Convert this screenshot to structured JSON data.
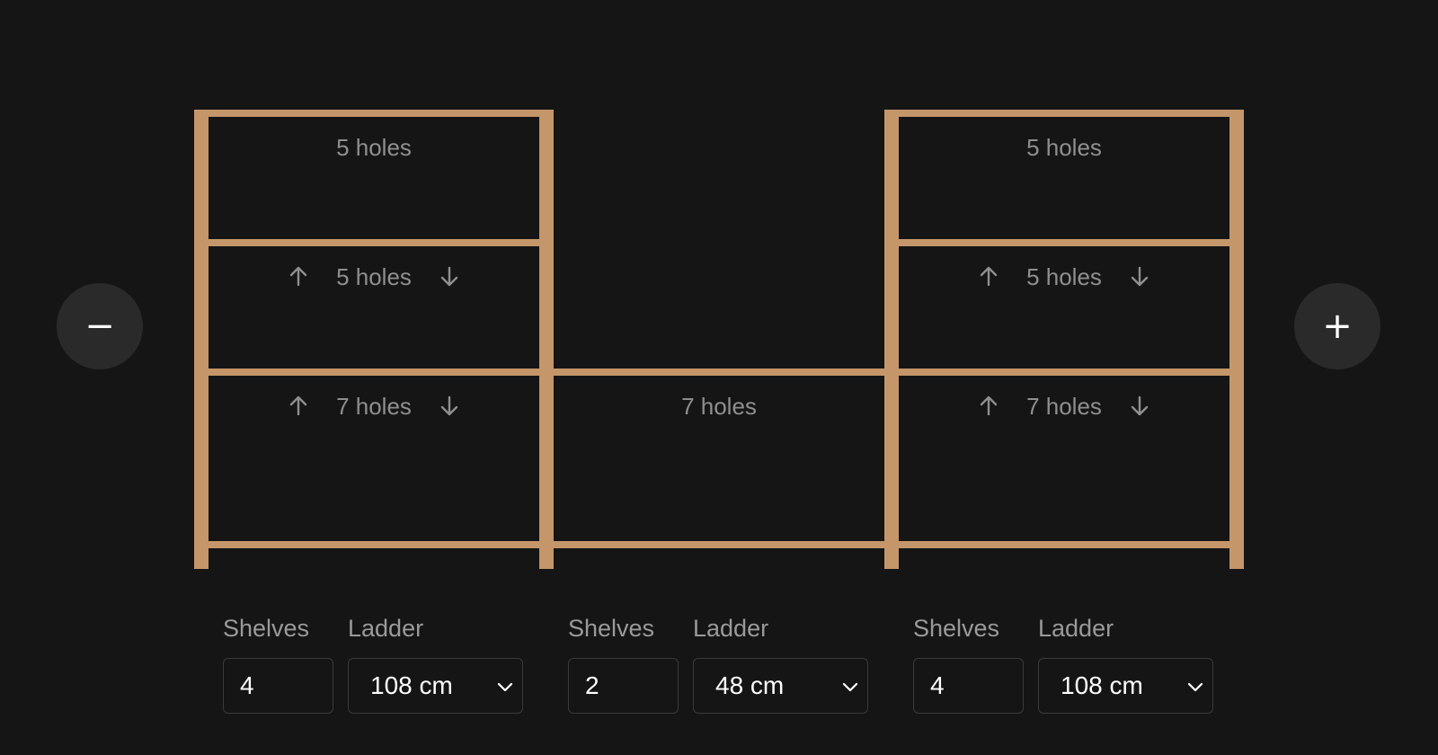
{
  "actions": {
    "remove_icon": "minus-icon",
    "remove_glyph": "−",
    "add_icon": "plus-icon",
    "add_glyph": "+"
  },
  "colors": {
    "background": "#151515",
    "wood": "#c4966a",
    "button_bg": "#2a2a2a",
    "muted_text": "#8f8f8f"
  },
  "sections": [
    {
      "gaps": [
        {
          "label": "5 holes",
          "arrows": false
        },
        {
          "label": "5 holes",
          "arrows": true
        },
        {
          "label": "7 holes",
          "arrows": true
        }
      ],
      "shelves_label": "Shelves",
      "shelves_value": "4",
      "ladder_label": "Ladder",
      "ladder_value": "108 cm"
    },
    {
      "gaps": [
        {
          "label": "7 holes",
          "arrows": false
        }
      ],
      "shelves_label": "Shelves",
      "shelves_value": "2",
      "ladder_label": "Ladder",
      "ladder_value": "48 cm"
    },
    {
      "gaps": [
        {
          "label": "5 holes",
          "arrows": false
        },
        {
          "label": "5 holes",
          "arrows": true
        },
        {
          "label": "7 holes",
          "arrows": true
        }
      ],
      "shelves_label": "Shelves",
      "shelves_value": "4",
      "ladder_label": "Ladder",
      "ladder_value": "108 cm"
    }
  ]
}
